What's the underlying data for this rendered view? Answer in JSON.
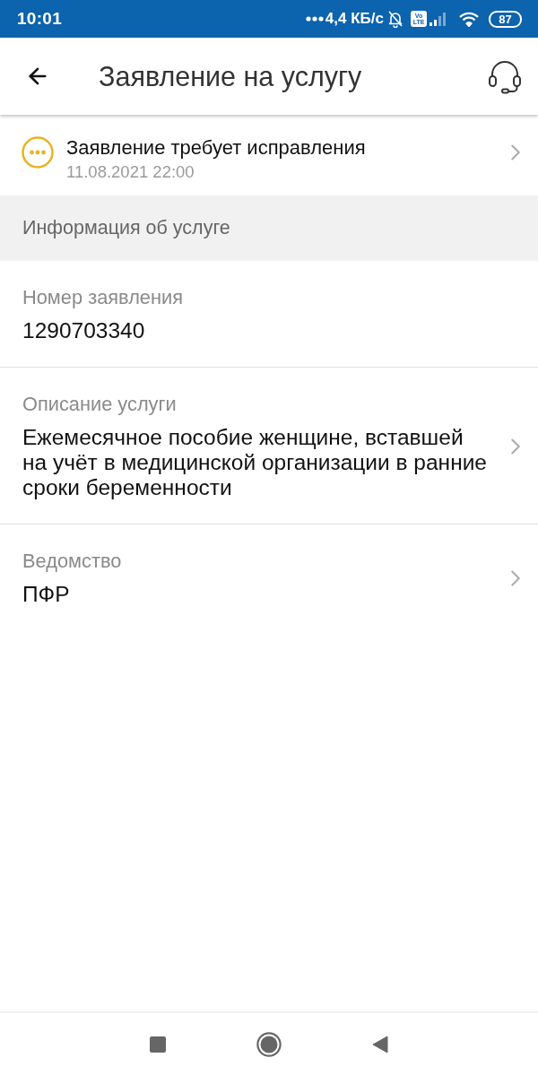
{
  "status_bar": {
    "time": "10:01",
    "speed": "4,4 КБ/с",
    "volte": {
      "top": "Vo",
      "bottom": "LTE"
    },
    "battery": "87"
  },
  "app_bar": {
    "title": "Заявление на услугу"
  },
  "status": {
    "kind": "needs_correction",
    "title": "Заявление требует исправления",
    "date": "11.08.2021 22:00"
  },
  "section": {
    "title": "Информация об услуге"
  },
  "fields": [
    {
      "label": "Номер заявления",
      "value": "1290703340",
      "navigable": false
    },
    {
      "label": "Описание услуги",
      "value": "Ежемесячное пособие женщине, вставшей на учёт в медицинской организации в ранние сроки беременности",
      "navigable": true
    },
    {
      "label": "Ведомство",
      "value": "ПФР",
      "navigable": true
    }
  ]
}
